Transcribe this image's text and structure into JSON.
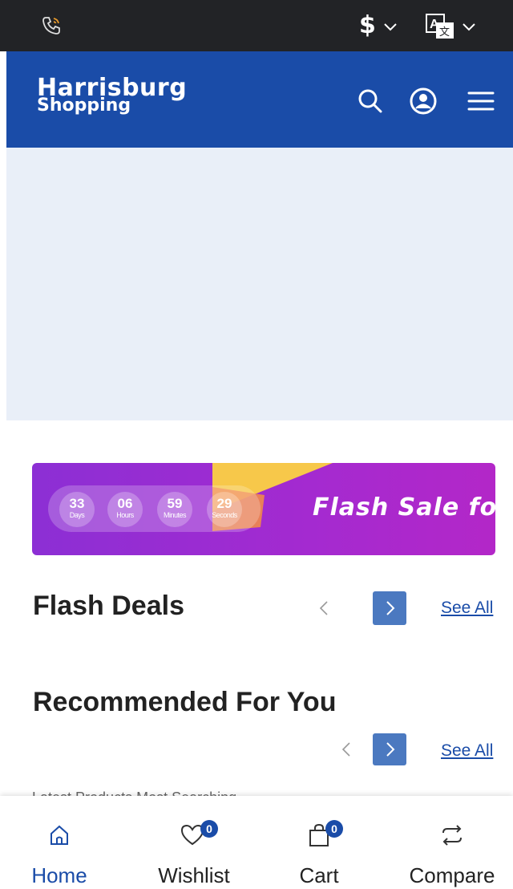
{
  "topbar": {
    "currency_symbol": "$",
    "icons": [
      "phone-icon",
      "chevron-down-icon",
      "translate-icon",
      "chevron-down-icon"
    ]
  },
  "header": {
    "logo_line1": "Harrisburg",
    "logo_line2": "Shopping",
    "icons": [
      "search-icon",
      "account-icon",
      "menu-icon"
    ],
    "background": "#1a4ca8"
  },
  "flash_banner": {
    "countdown": [
      {
        "value": "33",
        "label": "Days"
      },
      {
        "value": "06",
        "label": "Hours"
      },
      {
        "value": "59",
        "label": "Minutes"
      },
      {
        "value": "29",
        "label": "Seconds"
      }
    ],
    "text": "Flash Sale for A"
  },
  "flash_deals": {
    "title": "Flash Deals",
    "see_all": "See All"
  },
  "recommended": {
    "title": "Recommended For You",
    "see_all": "See All",
    "tabs_peek": "Latest Products    Most Searching"
  },
  "bottom_nav": {
    "items": [
      {
        "label": "Home",
        "icon": "home-icon",
        "active": true
      },
      {
        "label": "Wishlist",
        "icon": "heart-icon",
        "badge": "0"
      },
      {
        "label": "Cart",
        "icon": "bag-icon",
        "badge": "0"
      },
      {
        "label": "Compare",
        "icon": "compare-icon"
      }
    ],
    "active_color": "#1a4ca8"
  }
}
